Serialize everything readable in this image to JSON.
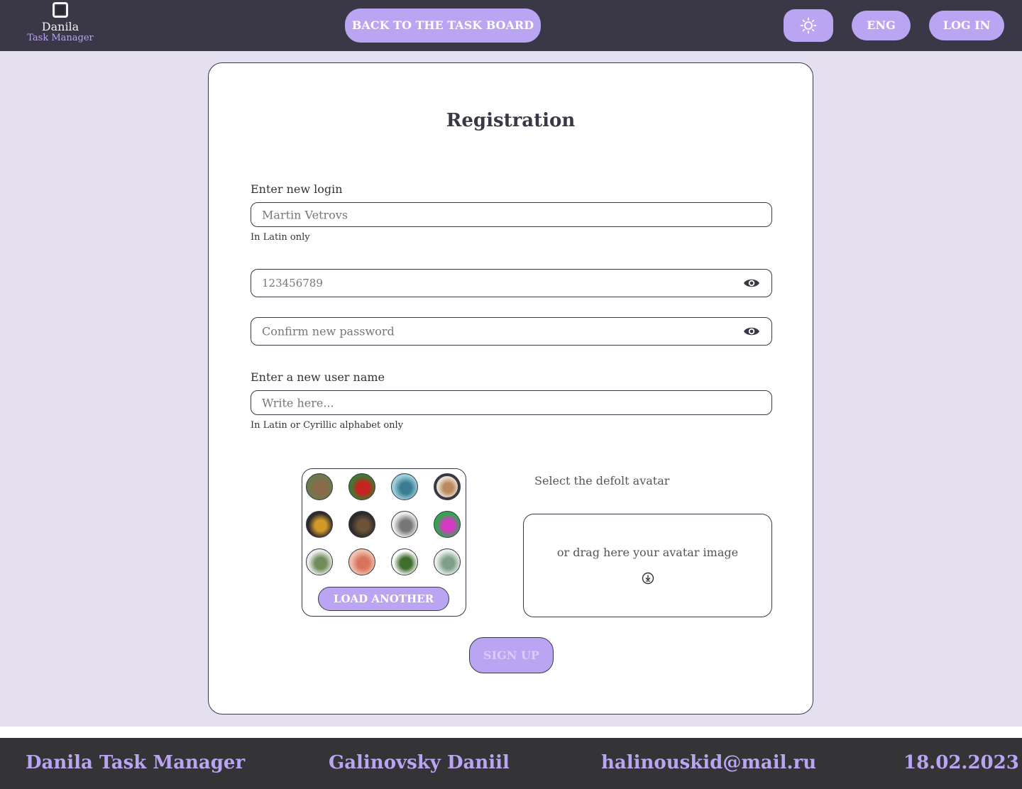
{
  "header": {
    "logo_title": "Danila",
    "logo_subtitle": "Task Manager",
    "back_button": "BACK TO THE TASK BOARD",
    "theme_icon": "sun-icon",
    "language": "ENG",
    "login_button": "LOG IN"
  },
  "form": {
    "title": "Registration",
    "login_label": "Enter new login",
    "login_value": "Martin Vetrovs",
    "login_hint": "In Latin only",
    "password_value": "123456789",
    "confirm_placeholder": "Confirm new password",
    "username_label": "Enter a new user name",
    "username_placeholder": "Write here...",
    "username_hint": "In Latin or Cyrillic alphabet only",
    "load_another": "LOAD ANOTHER",
    "select_default_avatar": "Select the defolt avatar",
    "drag_text": "or drag here your avatar image",
    "signup_button": "SIGN UP"
  },
  "avatars": [
    {
      "name": "rabbit",
      "colors": [
        "#6b7a4e",
        "#8b6a4a"
      ]
    },
    {
      "name": "parrot",
      "colors": [
        "#3f7a32",
        "#c8221e"
      ]
    },
    {
      "name": "whale",
      "colors": [
        "#9ed0dc",
        "#3b7c94"
      ]
    },
    {
      "name": "lion",
      "colors": [
        "#e8dccc",
        "#b88a5c"
      ],
      "selected": true
    },
    {
      "name": "dancer",
      "colors": [
        "#2d2a2a",
        "#d39a2a"
      ]
    },
    {
      "name": "monkey",
      "colors": [
        "#2a2a2a",
        "#6b5238"
      ]
    },
    {
      "name": "sketch",
      "colors": [
        "#eeeeee",
        "#777777"
      ]
    },
    {
      "name": "stained-glass",
      "colors": [
        "#2ea84a",
        "#d43ac4"
      ]
    },
    {
      "name": "botanical",
      "colors": [
        "#ededed",
        "#6f8c5a"
      ]
    },
    {
      "name": "flower",
      "colors": [
        "#f1c1b0",
        "#d8745c"
      ]
    },
    {
      "name": "leaves",
      "colors": [
        "#ffffff",
        "#3f6e2e"
      ]
    },
    {
      "name": "herb",
      "colors": [
        "#ebefed",
        "#7fa088"
      ]
    }
  ],
  "footer": {
    "app_name": "Danila Task Manager",
    "author": "Galinovsky Daniil",
    "email": "halinouskid@mail.ru",
    "date": "18.02.2023"
  },
  "colors": {
    "accent": "#b9a5f2",
    "header_bg": "#3a3846",
    "page_bg": "#e4e0ef",
    "footer_bg": "#343336"
  }
}
